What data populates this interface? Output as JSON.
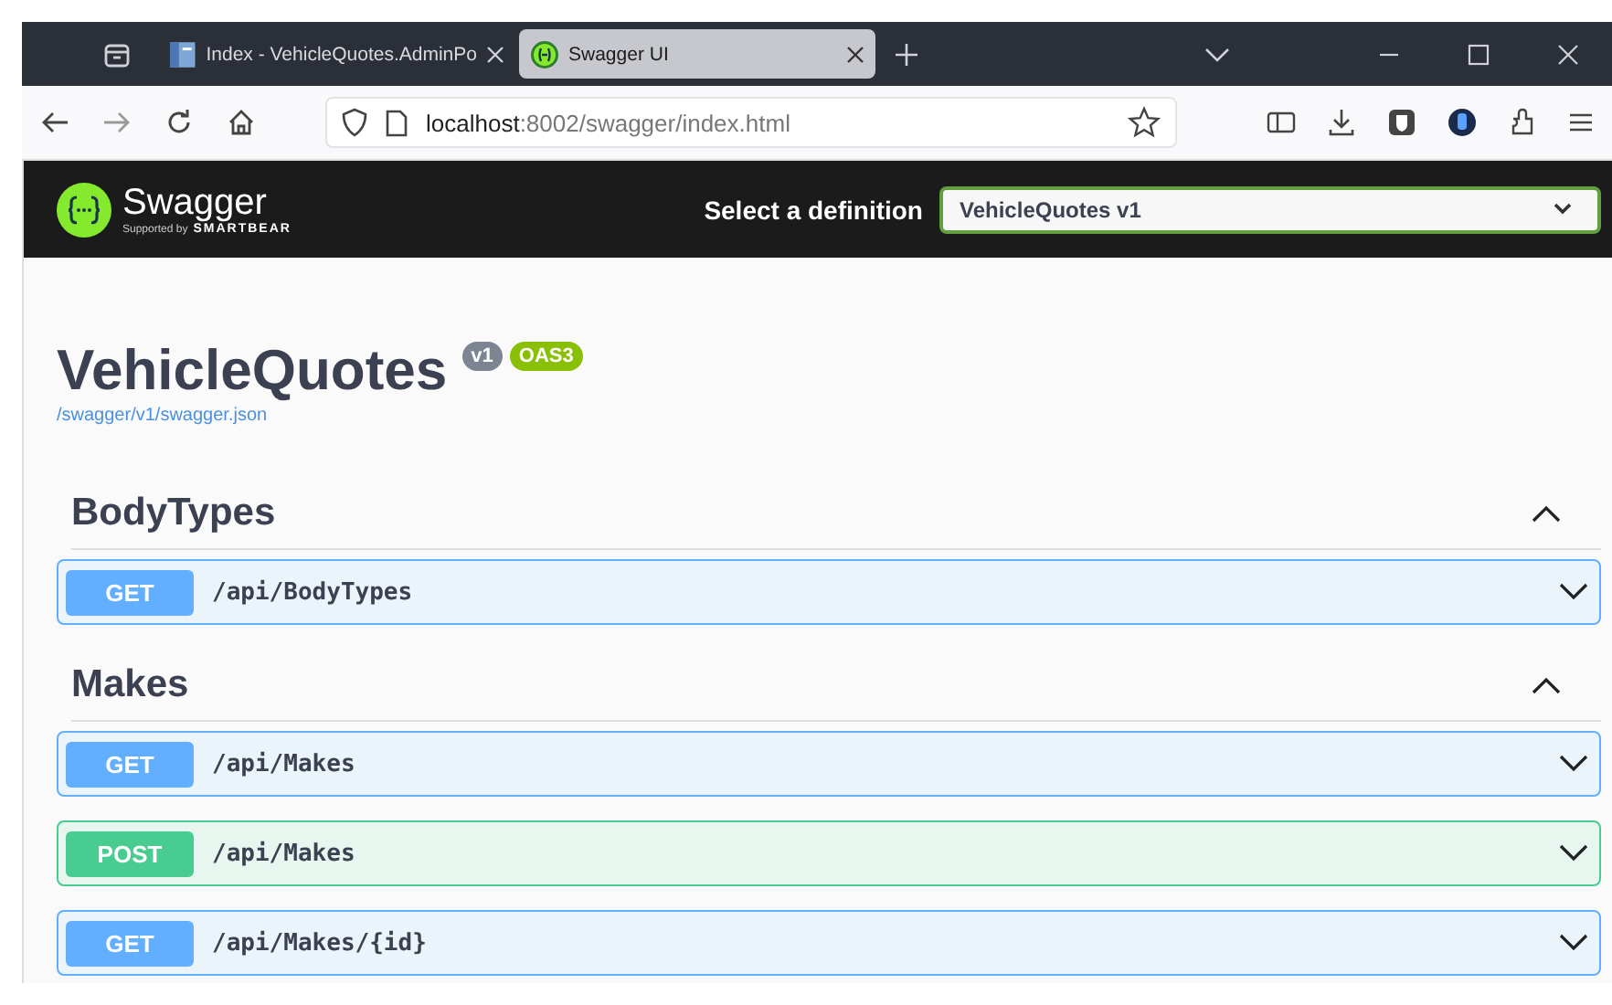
{
  "browser": {
    "tabs": [
      {
        "title": "Index - VehicleQuotes.AdminPo",
        "selected": false,
        "kind": "page"
      },
      {
        "title": "Swagger UI",
        "selected": true,
        "kind": "swagger"
      }
    ],
    "address": {
      "host": "localhost",
      "rest": ":8002/swagger/index.html"
    }
  },
  "header": {
    "logo_text": "Swagger",
    "logo_sub": "Supported by",
    "logo_brand": "SMARTBEAR",
    "definition_label": "Select a definition",
    "definition_value": "VehicleQuotes v1"
  },
  "info": {
    "title": "VehicleQuotes",
    "version": "v1",
    "spec": "OAS3",
    "link": "/swagger/v1/swagger.json"
  },
  "sections": [
    {
      "name": "BodyTypes",
      "expanded": true,
      "operations": [
        {
          "kind": "get",
          "method": "GET",
          "path": "/api/BodyTypes"
        }
      ]
    },
    {
      "name": "Makes",
      "expanded": true,
      "operations": [
        {
          "kind": "get",
          "method": "GET",
          "path": "/api/Makes"
        },
        {
          "kind": "post",
          "method": "POST",
          "path": "/api/Makes"
        },
        {
          "kind": "get",
          "method": "GET",
          "path": "/api/Makes/{id}"
        }
      ]
    }
  ]
}
